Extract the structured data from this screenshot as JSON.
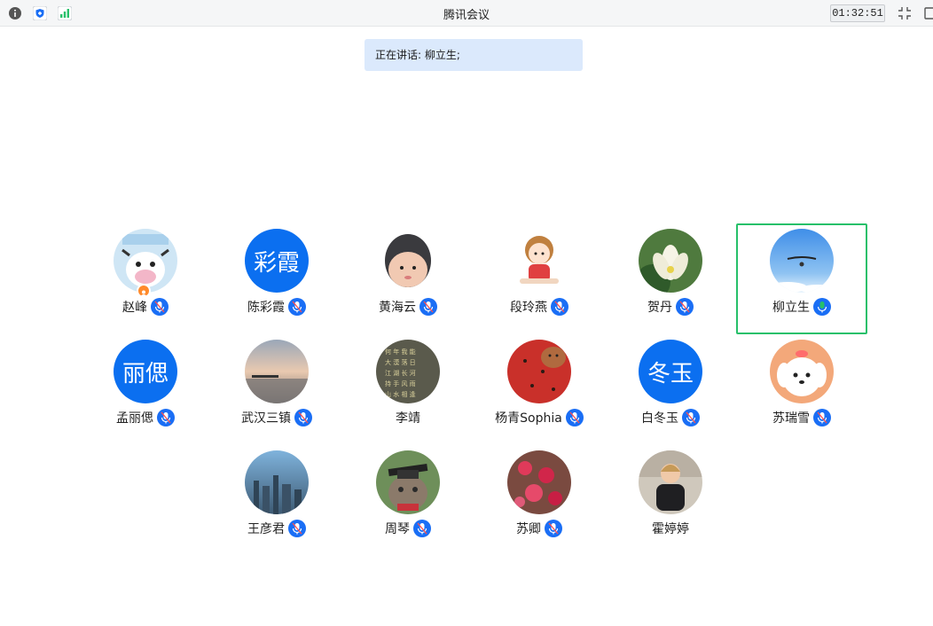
{
  "window": {
    "title": "腾讯会议",
    "timer": "01:32:51"
  },
  "banner": {
    "text": "正在讲话: 柳立生;"
  },
  "participants": [
    {
      "name": "赵峰",
      "avatar": "photo-cow-cartoon",
      "mic": "muted",
      "host": true
    },
    {
      "name": "陈彩霞",
      "avatar_text": "彩霞",
      "mic": "muted"
    },
    {
      "name": "黄海云",
      "avatar": "photo-baby",
      "mic": "muted"
    },
    {
      "name": "段玲燕",
      "avatar": "photo-cartoon-girl",
      "mic": "muted"
    },
    {
      "name": "贺丹",
      "avatar": "photo-lotus",
      "mic": "muted"
    },
    {
      "name": "柳立生",
      "avatar": "photo-glider-sky",
      "mic": "active",
      "speaking": true
    },
    {
      "name": "孟丽偲",
      "avatar_text": "丽偲",
      "mic": "muted"
    },
    {
      "name": "武汉三镇",
      "avatar": "photo-lake-sunset",
      "mic": "muted"
    },
    {
      "name": "李靖",
      "avatar": "photo-calligraphy",
      "mic": "none"
    },
    {
      "name": "杨青Sophia",
      "avatar": "photo-watermelon",
      "mic": "muted"
    },
    {
      "name": "白冬玉",
      "avatar_text": "冬玉",
      "mic": "muted"
    },
    {
      "name": "苏瑞雪",
      "avatar": "photo-cartoon-dog",
      "mic": "muted"
    },
    {
      "name": "王彦君",
      "avatar": "photo-city",
      "mic": "muted"
    },
    {
      "name": "周琴",
      "avatar": "photo-cat-graduation",
      "mic": "muted"
    },
    {
      "name": "苏卿",
      "avatar": "photo-red-flowers",
      "mic": "muted"
    },
    {
      "name": "霍婷婷",
      "avatar": "photo-woman",
      "mic": "none"
    }
  ],
  "colors": {
    "accent": "#1a6ef5",
    "active": "#27c06a",
    "banner_bg": "#dbe9fc"
  }
}
